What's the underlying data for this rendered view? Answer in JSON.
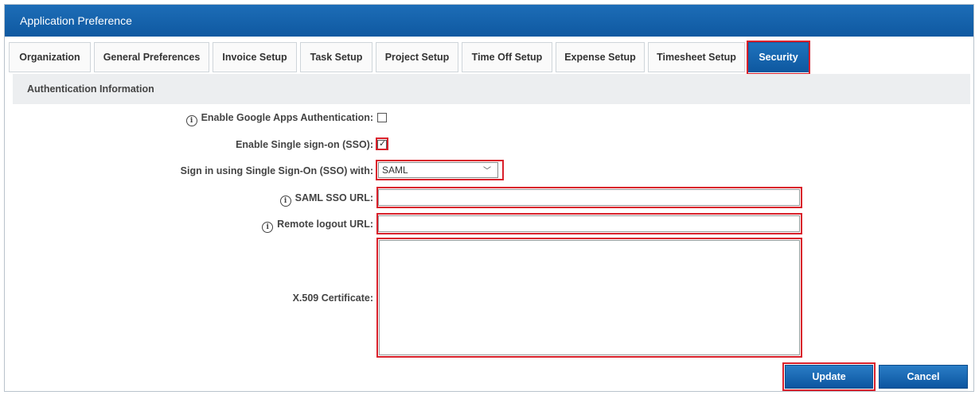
{
  "window": {
    "title": "Application Preference"
  },
  "tabs": [
    {
      "label": "Organization",
      "active": false
    },
    {
      "label": "General Preferences",
      "active": false
    },
    {
      "label": "Invoice Setup",
      "active": false
    },
    {
      "label": "Task Setup",
      "active": false
    },
    {
      "label": "Project Setup",
      "active": false
    },
    {
      "label": "Time Off Setup",
      "active": false
    },
    {
      "label": "Expense Setup",
      "active": false
    },
    {
      "label": "Timesheet Setup",
      "active": false
    },
    {
      "label": "Security",
      "active": true
    }
  ],
  "section": {
    "title": "Authentication Information"
  },
  "form": {
    "google_auth": {
      "label": "Enable Google Apps Authentication:",
      "checked": false
    },
    "sso_enable": {
      "label": "Enable Single sign-on (SSO):",
      "checked": true
    },
    "sso_with": {
      "label": "Sign in using Single Sign-On (SSO) with:",
      "value": "SAML"
    },
    "saml_url": {
      "label": "SAML SSO URL:",
      "value": ""
    },
    "logout_url": {
      "label": "Remote logout URL:",
      "value": ""
    },
    "certificate": {
      "label": "X.509 Certificate:",
      "value": ""
    }
  },
  "buttons": {
    "update": "Update",
    "cancel": "Cancel"
  },
  "colors": {
    "titlebar": "#1565ad",
    "highlight": "#d9202b",
    "accent": "#0e58a0"
  },
  "icons": {
    "info": "info-icon",
    "dropdown": "chevron-down-icon",
    "check": "checkmark-icon"
  }
}
